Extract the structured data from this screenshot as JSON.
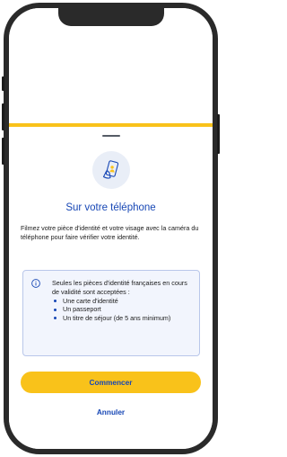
{
  "sheet": {
    "title": "Sur votre téléphone",
    "description": "Filmez votre pièce d'identité et votre visage avec la caméra du téléphone pour faire vérifier votre identité.",
    "info": {
      "intro": "Seules les pièces d'identité françaises en cours de validité sont acceptées :",
      "items": [
        "Une carte d'identité",
        "Un passeport",
        "Un titre de séjour (de 5 ans minimum)"
      ]
    },
    "primary_button": "Commencer",
    "secondary_button": "Annuler"
  },
  "colors": {
    "accent_blue": "#1747b5",
    "accent_yellow": "#f9c21a",
    "info_bg": "#f2f5fd",
    "info_border": "#b9c7ea",
    "icon_bg": "#e9eef7"
  },
  "icons": {
    "header_icon": "phone-selfie-icon",
    "info_icon": "info-circle-icon"
  }
}
